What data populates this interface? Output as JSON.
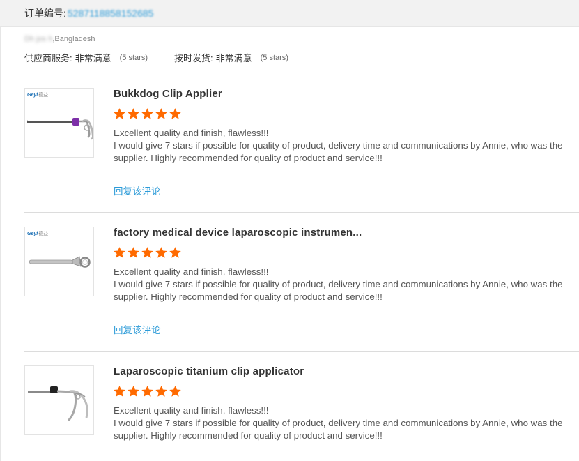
{
  "order": {
    "label": "订单编号:",
    "number": "5287118858152685"
  },
  "buyer": {
    "masked_name": "Dh  jos  h",
    "country": ",Bangladesh"
  },
  "supplier_ratings": [
    {
      "label": "供应商服务:",
      "value": "非常满意",
      "stars": "(5 stars)"
    },
    {
      "label": "按时发货:",
      "value": "非常满意",
      "stars": "(5 stars)"
    }
  ],
  "reviews": [
    {
      "product_title": "Bukkdog Clip Applier",
      "rating": 5,
      "brand": "Geyi",
      "brand_cn": "德益",
      "comment_line1": "Excellent quality and finish, flawless!!!",
      "comment_line2": "I would give 7 stars if possible for quality of product, delivery time and communications by Annie, who was the supplier. Highly recommended for quality of product and service!!!",
      "reply_label": "回复该评论"
    },
    {
      "product_title": "factory medical device laparoscopic instrumen...",
      "rating": 5,
      "brand": "Geyi",
      "brand_cn": "德益",
      "comment_line1": "Excellent quality and finish, flawless!!!",
      "comment_line2": "I would give 7 stars if possible for quality of product, delivery time and communications by Annie, who was the supplier. Highly recommended for quality of product and service!!!",
      "reply_label": "回复该评论"
    },
    {
      "product_title": "Laparoscopic titanium clip applicator",
      "rating": 5,
      "comment_line1": "Excellent quality and finish, flawless!!!",
      "comment_line2": "I would give 7 stars if possible for quality of product, delivery time and communications by Annie, who was the supplier. Highly recommended for quality of product and service!!!"
    }
  ],
  "colors": {
    "link": "#2c9bd8",
    "star": "#ff6a00",
    "order_bar_bg": "#f2f2f2"
  },
  "icons": {
    "star": "star-icon"
  }
}
